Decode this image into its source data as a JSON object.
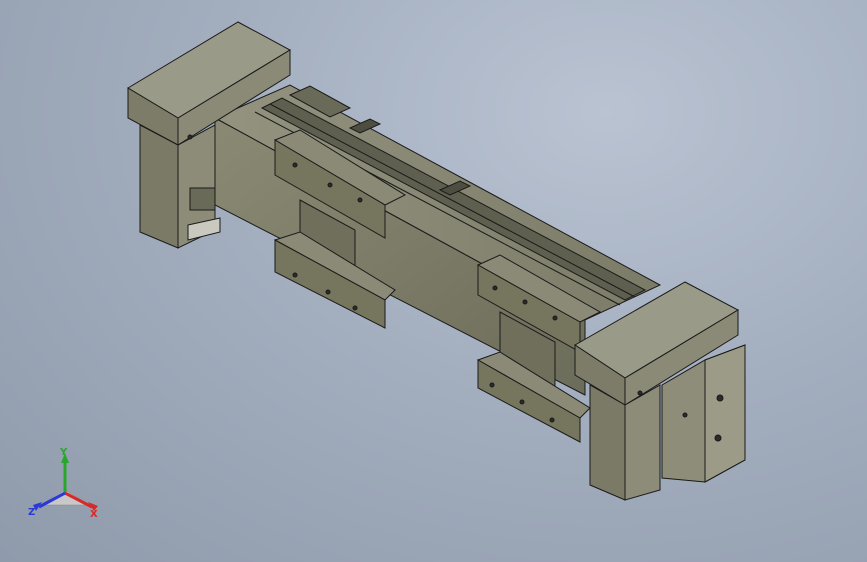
{
  "viewport": {
    "background_top": "#b9c3d2",
    "background_bottom": "#8f9aab"
  },
  "model": {
    "body_color": "#7d7d68",
    "body_dark": "#5e5e4e",
    "cap_color": "#8a8a78",
    "edge_color": "#1a1a1a"
  },
  "triad": {
    "x_label": "X",
    "y_label": "Y",
    "z_label": "Z",
    "x_color": "#d62a2a",
    "y_color": "#2aa62a",
    "z_color": "#2a3ad6"
  }
}
